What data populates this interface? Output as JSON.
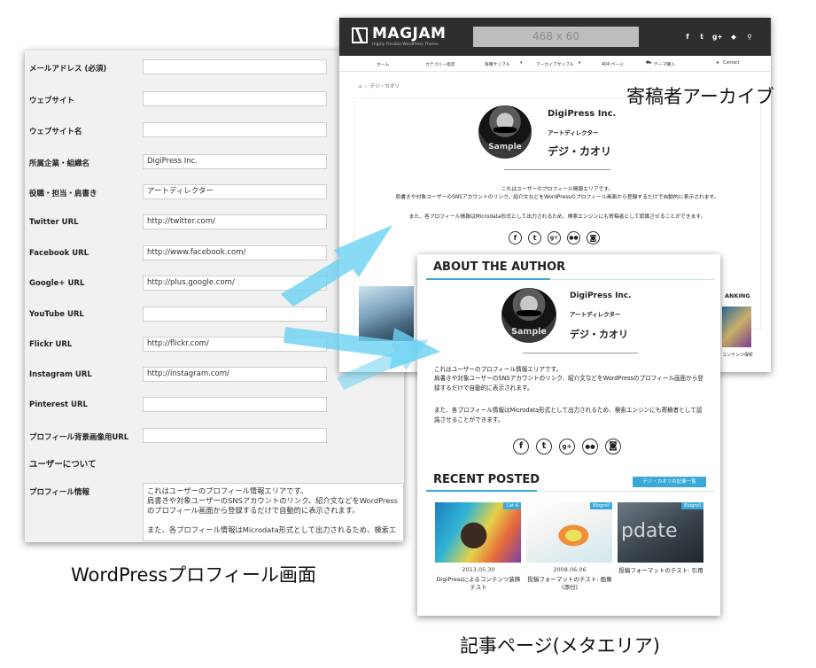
{
  "wordpress_profile": {
    "fields": [
      {
        "label": "メールアドレス (必須)",
        "value": ""
      },
      {
        "label": "ウェブサイト",
        "value": ""
      },
      {
        "label": "ウェブサイト名",
        "value": ""
      },
      {
        "label": "所属企業・組織名",
        "value": "DigiPress Inc."
      },
      {
        "label": "役職・担当・肩書き",
        "value": "アートディレクター"
      },
      {
        "label": "Twitter URL",
        "value": "http://twitter.com/"
      },
      {
        "label": "Facebook URL",
        "value": "http://www.facebook.com/"
      },
      {
        "label": "Google+ URL",
        "value": "http://plus.google.com/"
      },
      {
        "label": "YouTube URL",
        "value": ""
      },
      {
        "label": "Flickr URL",
        "value": "http://flickr.com/"
      },
      {
        "label": "Instagram URL",
        "value": "http://instagram.com/"
      },
      {
        "label": "Pinterest URL",
        "value": ""
      },
      {
        "label": "プロフィール背景画像用URL",
        "value": ""
      }
    ],
    "about_heading": "ユーザーについて",
    "profile_label": "プロフィール情報",
    "profile_text": "これはユーザーのプロフィール情報エリアです。\n肩書きや対象ユーザーのSNSアカウントのリンク、紹介文などをWordPressのプロフィール画面から登録するだけで自動的に表示されます。\n\nまた、各プロフィール情報はMicrodata形式として出力されるため、検索エ"
  },
  "archive_page": {
    "logo_text": "MAGJAM",
    "logo_sub": "Highly Flexible WordPress Theme",
    "banner": "468 x 60",
    "nav": [
      "ホーム",
      "カテゴリー指定",
      "各種サンプル",
      "アーカイブサンプル",
      "404 ページ",
      "テーマ購入",
      "Contact"
    ],
    "breadcrumb": "デジ・カオリ",
    "company": "DigiPress Inc.",
    "role": "アートディレクター",
    "name": "デジ・カオリ",
    "avatar_label": "Sample",
    "desc1": "これはユーザーのプロフィール情報エリアです。",
    "desc2": "肩書きや対象ユーザーのSNSアカウントのリンク、紹介文などをWordPressのプロフィール画面から登録するだけで自動的に表示されます。",
    "desc3": "また、各プロフィール情報はMicrodata形式として出力されるため、検索エンジンにも寄稿者として認識させることができます。",
    "side_label": "ANKING",
    "side_caption": "コンテンツ保析"
  },
  "article_page": {
    "about_title": "ABOUT THE AUTHOR",
    "company": "DigiPress Inc.",
    "role": "アートディレクター",
    "name": "デジ・カオリ",
    "avatar_label": "Sample",
    "desc1": "これはユーザーのプロフィール情報エリアです。",
    "desc2": "肩書きや対象ユーザーのSNSアカウントのリンク、紹介文などをWordPressのプロフィール画面から登",
    "desc3": "録するだけで自動的に表示されます。",
    "desc4": "また、各プロフィール情報はMicrodata形式として出力されるため、検索エンジンにも寄稿者として認",
    "desc5": "識させることができます。",
    "recent_title": "RECENT POSTED",
    "all_posts_button": "デジ・カオリの記事一覧",
    "posts": [
      {
        "badge": "Cat A",
        "date": "2013.05.30",
        "title": "DigiPressによるコンテンツ装飾テスト"
      },
      {
        "badge": "Blogroll",
        "date": "2008.06.06",
        "title": "投稿フォーマットのテスト: 画像 (添付)"
      },
      {
        "badge": "Blogroll",
        "date": "",
        "title": "投稿フォーマットのテスト: 引用",
        "overlay": "pdate"
      }
    ]
  },
  "social_icons": [
    "facebook-icon",
    "twitter-icon",
    "google-plus-icon",
    "flickr-icon",
    "instagram-icon"
  ],
  "captions": {
    "archive": "寄稿者アーカイブ",
    "wordpress": "WordPressプロフィール画面",
    "article": "記事ページ(メタエリア)"
  },
  "colors": {
    "accent": "#3aa8d8",
    "arrow": "#6cd2f2",
    "header_dark": "#2e2e2e"
  }
}
